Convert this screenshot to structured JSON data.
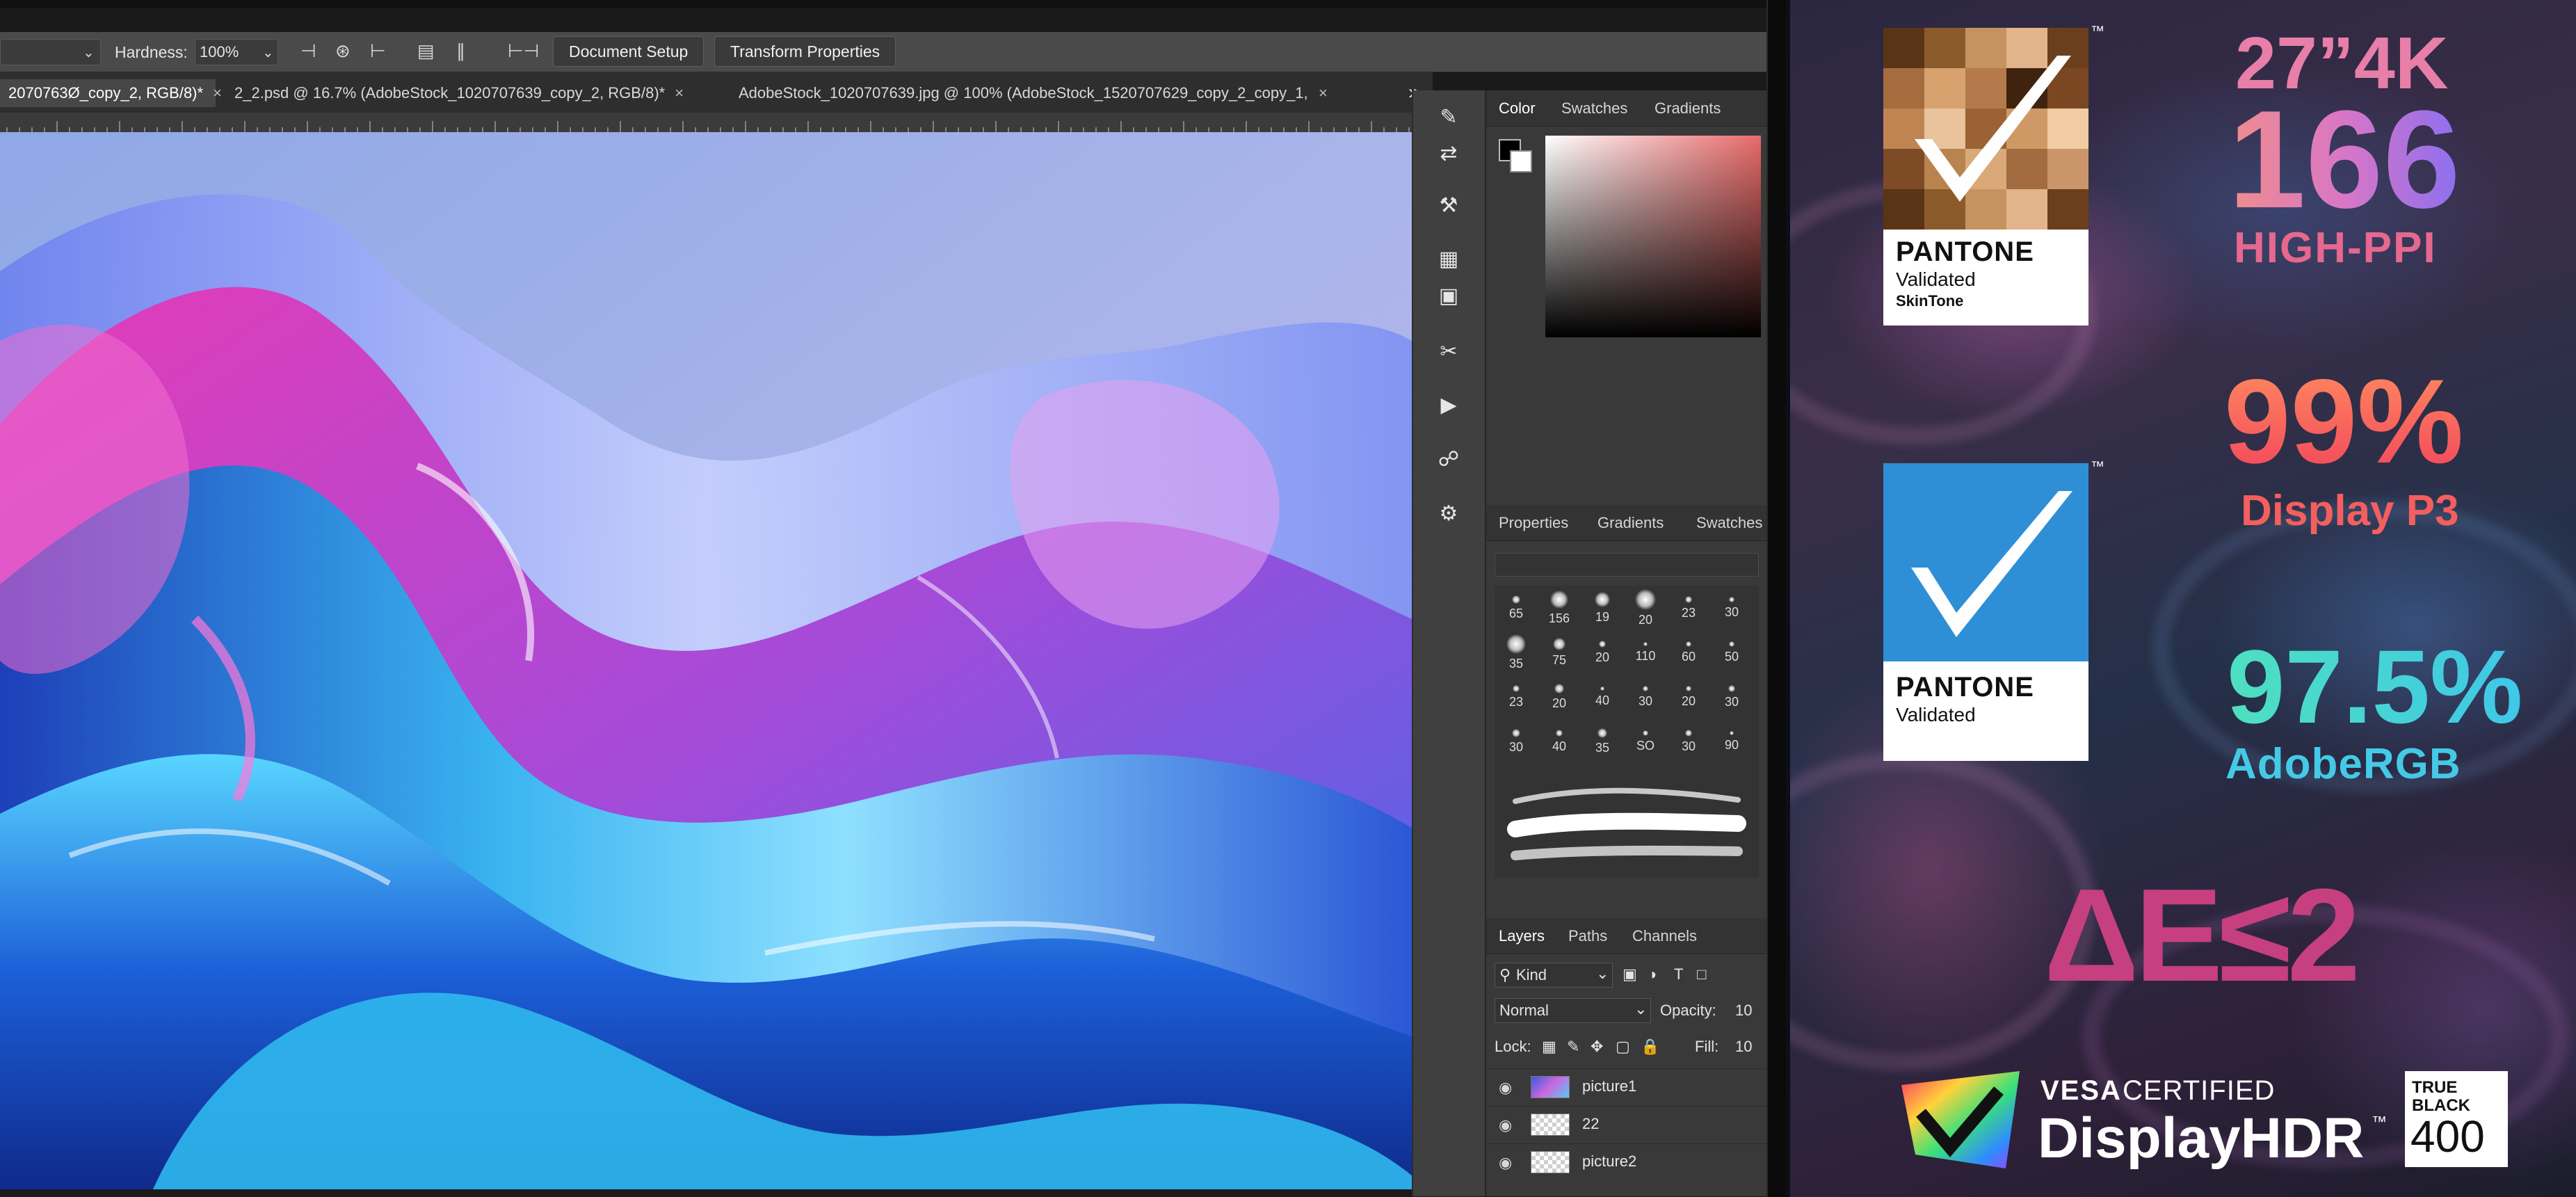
{
  "options_bar": {
    "hardness_label": "Hardness:",
    "hardness_value": "100%",
    "document_setup": "Document Setup",
    "transform_properties": "Transform Properties"
  },
  "doc_tabs": [
    {
      "label": "2070763Ø_copy_2, RGB/8)*",
      "close": "×"
    },
    {
      "label": "2_2.psd @ 16.7% (AdobeStock_1020707639_copy_2, RGB/8)*",
      "close": "×"
    },
    {
      "label": "AdobeStock_1020707639.jpg @ 100% (AdobeStock_1520707629_copy_2_copy_1, *",
      "close": "×"
    }
  ],
  "tabs_overflow": "»",
  "color_panel": {
    "tabs": [
      "Color",
      "Swatches",
      "Gradients"
    ]
  },
  "brush_panel": {
    "tabs": [
      "Properties",
      "Gradients",
      "Swatches"
    ],
    "sizes": [
      "65",
      "156",
      "19",
      "20",
      "23",
      "30",
      "35",
      "75",
      "20",
      "110",
      "60",
      "50",
      "23",
      "20",
      "40",
      "30",
      "20",
      "30",
      "30",
      "40",
      "35",
      "SO",
      "30",
      "90"
    ]
  },
  "layers_panel": {
    "tabs": [
      "Layers",
      "Paths",
      "Channels"
    ],
    "filter": "Kind",
    "blend_mode": "Normal",
    "opacity_label": "Opacity:",
    "opacity_value": "10",
    "lock_label": "Lock:",
    "fill_label": "Fill:",
    "fill_value": "10",
    "layers": [
      "picture1",
      "22",
      "picture2"
    ]
  },
  "promo": {
    "size": "27”4K",
    "ppi": "166",
    "ppi_label": "HIGH-PPI",
    "p3_value": "99%",
    "p3_label": "Display P3",
    "argb_value": "97.5%",
    "argb_label": "AdobeRGB",
    "delta_e": "ΔE≤2",
    "pantone1": {
      "brand": "PANTONE",
      "line1": "Validated",
      "line2": "SkinTone"
    },
    "pantone2": {
      "brand": "PANTONE",
      "line1": "Validated"
    },
    "tm": "™",
    "vesa_line1a": "VESA",
    "vesa_line1b": "CERTIFIED",
    "vesa_line2": "DisplayHDR",
    "tb_line1": "TRUE",
    "tb_line2": "BLACK",
    "tb_line3": "400"
  }
}
